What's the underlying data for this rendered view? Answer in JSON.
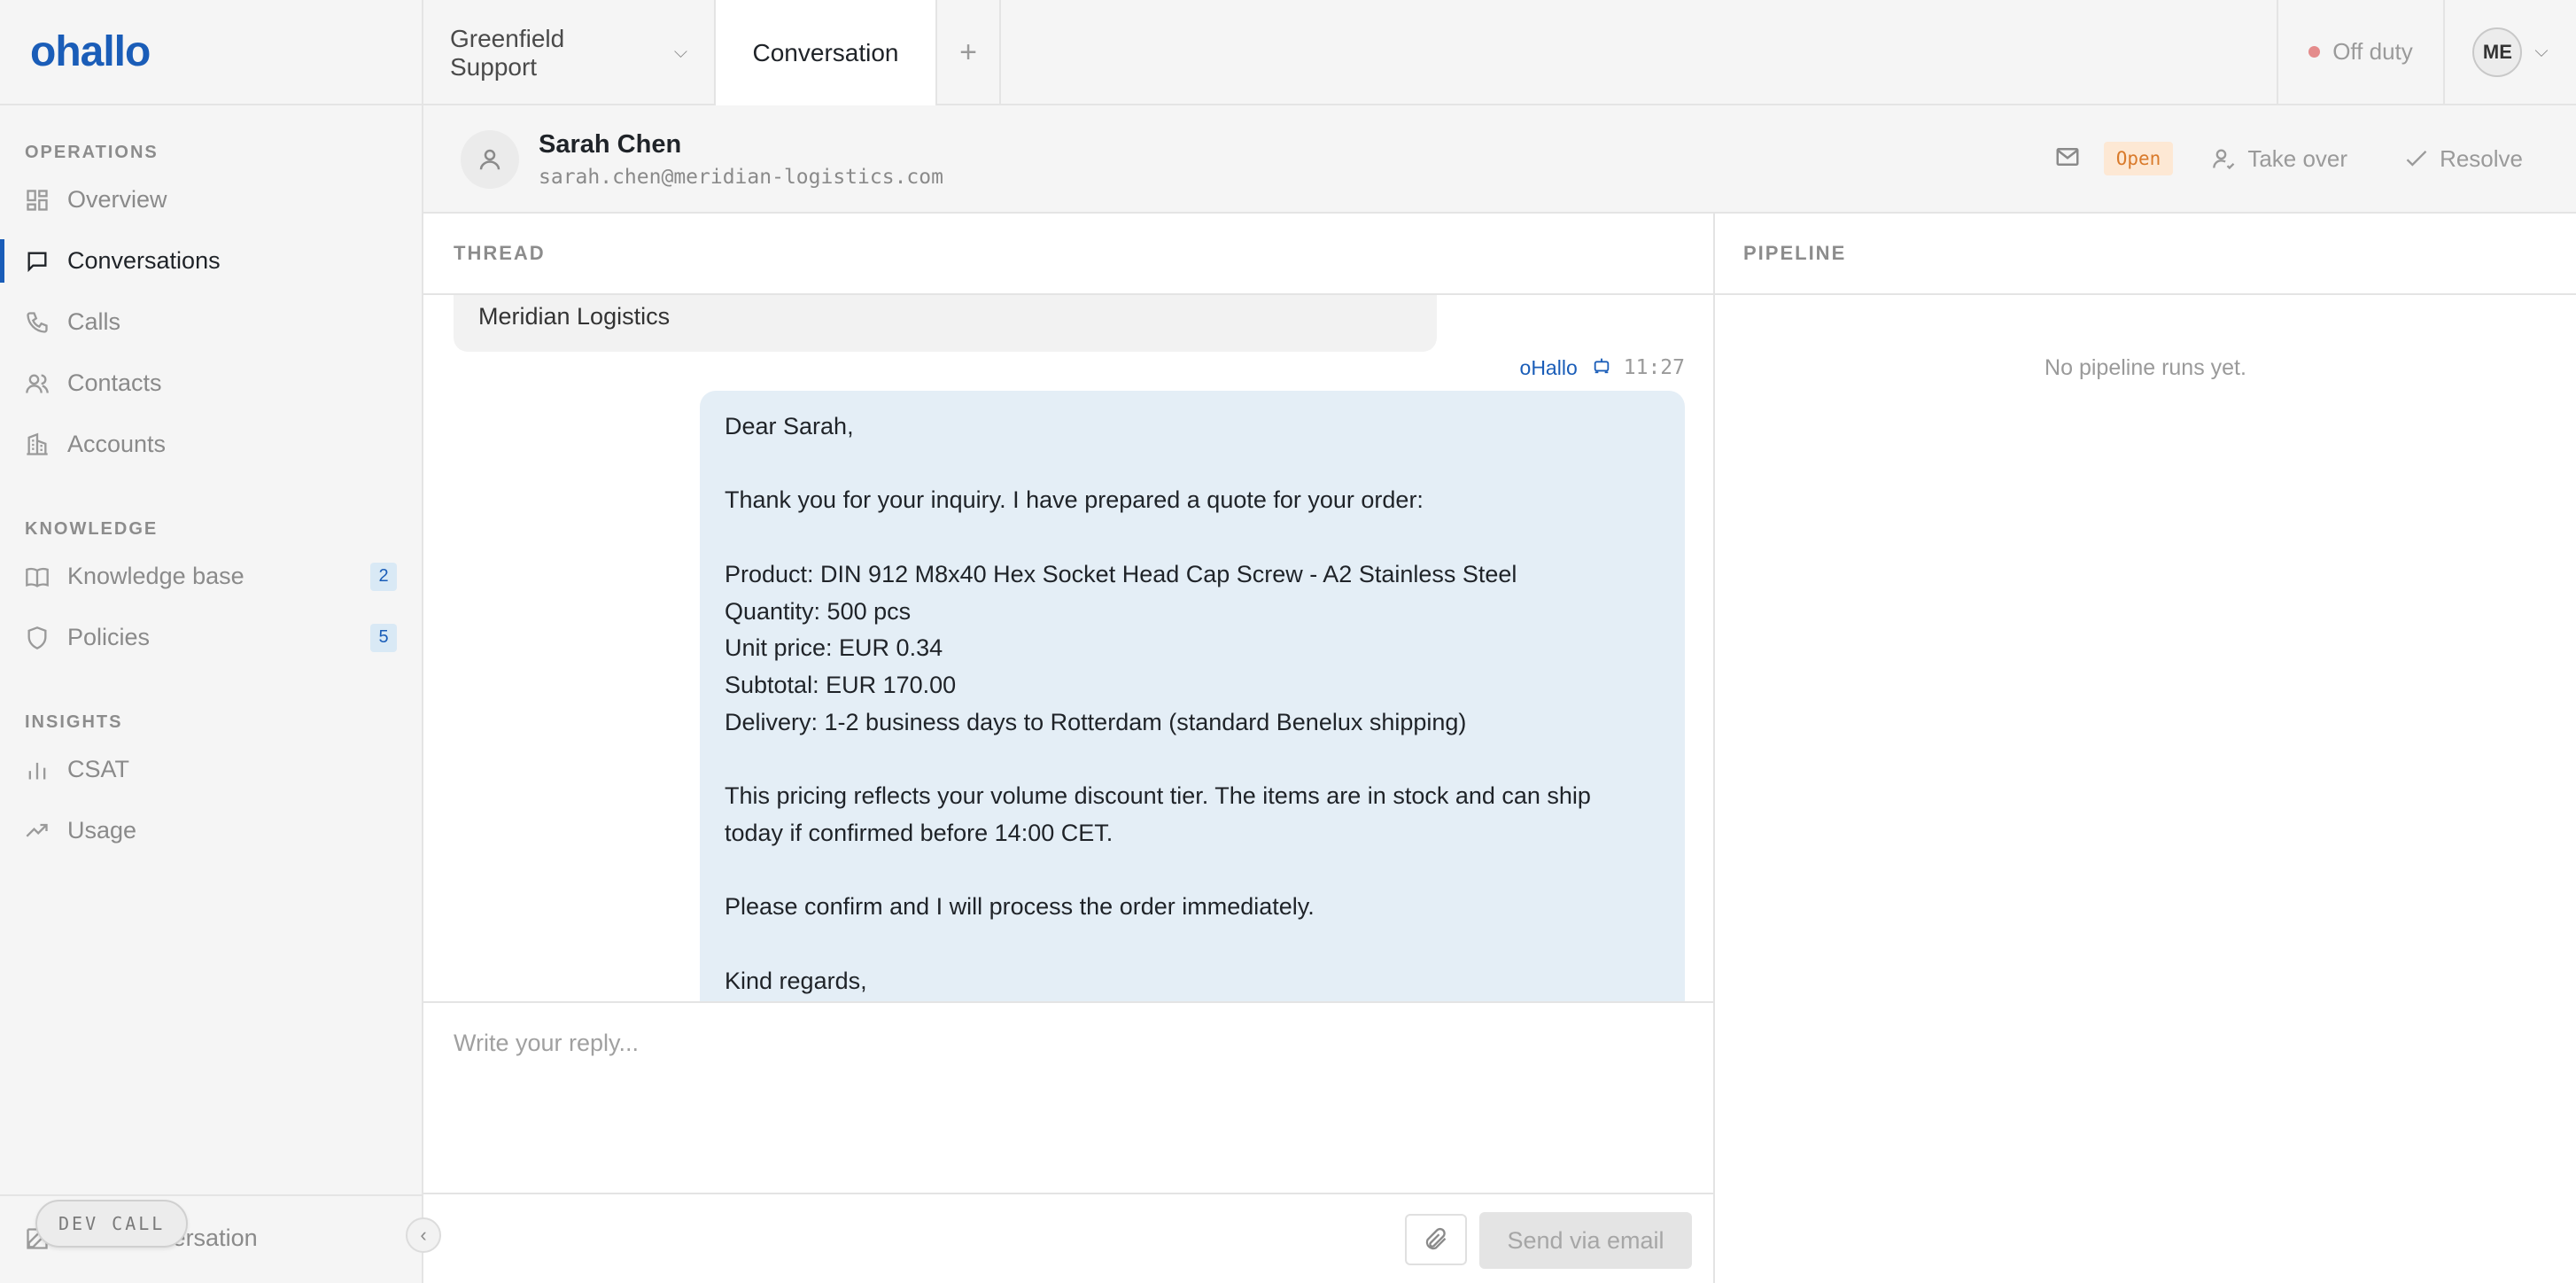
{
  "brand": {
    "logo": "ohallo",
    "accent": "#1a5db8"
  },
  "sidebar": {
    "sections": [
      {
        "heading": "OPERATIONS",
        "items": [
          {
            "label": "Overview",
            "icon": "grid-icon"
          },
          {
            "label": "Conversations",
            "icon": "chat-icon",
            "active": true
          },
          {
            "label": "Calls",
            "icon": "phone-icon"
          },
          {
            "label": "Contacts",
            "icon": "people-icon"
          },
          {
            "label": "Accounts",
            "icon": "building-icon"
          }
        ]
      },
      {
        "heading": "KNOWLEDGE",
        "items": [
          {
            "label": "Knowledge base",
            "icon": "book-icon",
            "badge": "2"
          },
          {
            "label": "Policies",
            "icon": "shield-icon",
            "badge": "5"
          }
        ]
      },
      {
        "heading": "INSIGHTS",
        "items": [
          {
            "label": "CSAT",
            "icon": "bar-chart-icon"
          },
          {
            "label": "Usage",
            "icon": "trend-icon"
          }
        ]
      }
    ],
    "footer": {
      "new_conversation": "New conversation",
      "dev_call": "DEV CALL"
    }
  },
  "topbar": {
    "workspace": "Greenfield Support",
    "active_tab": "Conversation",
    "add_tab": "+",
    "status": "Off duty",
    "status_color": "#e48b8b",
    "user_initials": "ME"
  },
  "conversation": {
    "contact_name": "Sarah Chen",
    "contact_email": "sarah.chen@meridian-logistics.com",
    "status_badge": "Open",
    "take_over": "Take over",
    "resolve": "Resolve"
  },
  "thread": {
    "heading": "THREAD",
    "prev_message_tail": "Meridian Logistics",
    "message": {
      "sender": "oHallo",
      "time": "11:27",
      "lines": [
        "Dear Sarah,",
        "",
        "Thank you for your inquiry. I have prepared a quote for your order:",
        "",
        "Product: DIN 912 M8x40 Hex Socket Head Cap Screw - A2 Stainless Steel",
        "Quantity: 500 pcs",
        "Unit price: EUR 0.34",
        "Subtotal: EUR 170.00",
        "Delivery: 1-2 business days to Rotterdam (standard Benelux shipping)",
        "",
        "This pricing reflects your volume discount tier. The items are in stock and can ship",
        "today if confirmed before 14:00 CET.",
        "",
        "Please confirm and I will process the order immediately.",
        "",
        "Kind regards,"
      ]
    },
    "composer": {
      "placeholder": "Write your reply...",
      "send_label": "Send via email"
    }
  },
  "pipeline": {
    "heading": "PIPELINE",
    "empty": "No pipeline runs yet."
  }
}
